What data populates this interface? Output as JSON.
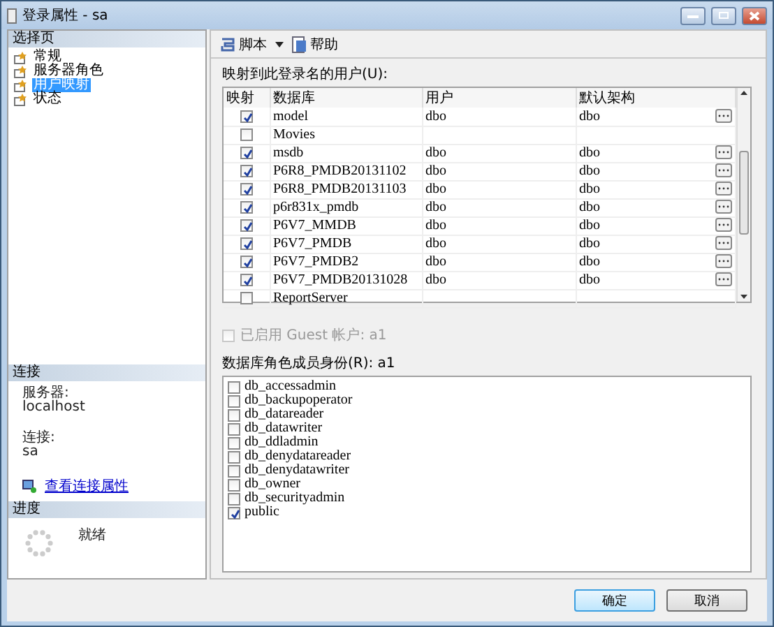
{
  "window": {
    "title": "登录属性 - sa"
  },
  "sidebar": {
    "header": "选择页",
    "items": [
      {
        "label": "常规",
        "selected": false
      },
      {
        "label": "服务器角色",
        "selected": false
      },
      {
        "label": "用户映射",
        "selected": true
      },
      {
        "label": "状态",
        "selected": false
      }
    ]
  },
  "connection": {
    "header": "连接",
    "server_label": "服务器:",
    "server": "localhost",
    "connection_label": "连接:",
    "connection": "sa",
    "link": "查看连接属性"
  },
  "progress": {
    "header": "进度",
    "status": "就绪"
  },
  "toolbar": {
    "script": "脚本",
    "help": "帮助"
  },
  "users": {
    "label": "映射到此登录名的用户(U):",
    "columns": [
      "映射",
      "数据库",
      "用户",
      "默认架构"
    ],
    "rows": [
      {
        "mapped": true,
        "database": "model",
        "user": "dbo",
        "schema": "dbo"
      },
      {
        "mapped": false,
        "database": "Movies",
        "user": "",
        "schema": ""
      },
      {
        "mapped": true,
        "database": "msdb",
        "user": "dbo",
        "schema": "dbo"
      },
      {
        "mapped": true,
        "database": "P6R8_PMDB20131102",
        "user": "dbo",
        "schema": "dbo"
      },
      {
        "mapped": true,
        "database": "P6R8_PMDB20131103",
        "user": "dbo",
        "schema": "dbo"
      },
      {
        "mapped": true,
        "database": "p6r831x_pmdb",
        "user": "dbo",
        "schema": "dbo"
      },
      {
        "mapped": true,
        "database": "P6V7_MMDB",
        "user": "dbo",
        "schema": "dbo"
      },
      {
        "mapped": true,
        "database": "P6V7_PMDB",
        "user": "dbo",
        "schema": "dbo"
      },
      {
        "mapped": true,
        "database": "P6V7_PMDB2",
        "user": "dbo",
        "schema": "dbo"
      },
      {
        "mapped": true,
        "database": "P6V7_PMDB20131028",
        "user": "dbo",
        "schema": "dbo"
      },
      {
        "mapped": false,
        "database": "ReportServer",
        "user": "",
        "schema": ""
      }
    ]
  },
  "guest": {
    "label": "已启用 Guest 帐户: a1",
    "checked": false,
    "disabled": true
  },
  "roles": {
    "label": "数据库角色成员身份(R): a1",
    "items": [
      {
        "name": "db_accessadmin",
        "checked": false
      },
      {
        "name": "db_backupoperator",
        "checked": false
      },
      {
        "name": "db_datareader",
        "checked": false
      },
      {
        "name": "db_datawriter",
        "checked": false
      },
      {
        "name": "db_ddladmin",
        "checked": false
      },
      {
        "name": "db_denydatareader",
        "checked": false
      },
      {
        "name": "db_denydatawriter",
        "checked": false
      },
      {
        "name": "db_owner",
        "checked": false
      },
      {
        "name": "db_securityadmin",
        "checked": false
      },
      {
        "name": "public",
        "checked": true
      }
    ]
  },
  "buttons": [
    {
      "label": "确定",
      "default": true
    },
    {
      "label": "取消",
      "default": false
    }
  ]
}
